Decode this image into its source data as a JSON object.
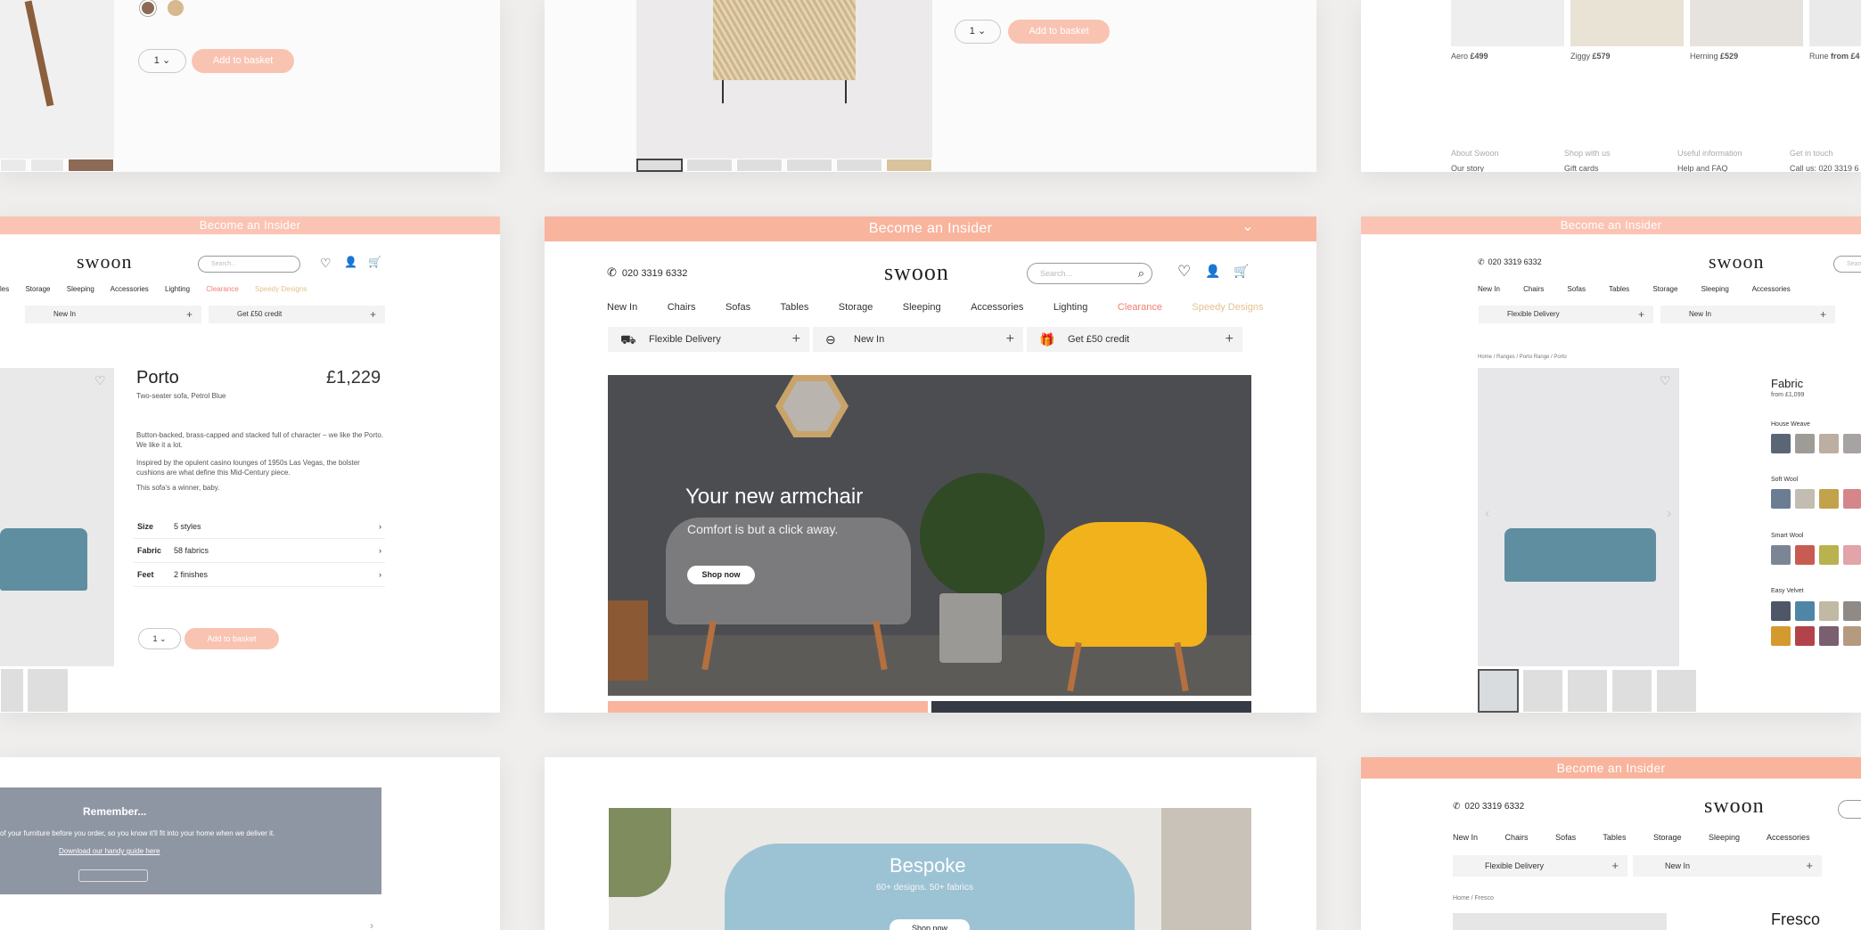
{
  "brand": {
    "logo": "swoon",
    "phone": "020 3319 6332",
    "accent": "#f9b49d",
    "search_placeholder": "Search..."
  },
  "insider": "Become an Insider",
  "nav": [
    "New In",
    "Chairs",
    "Sofas",
    "Tables",
    "Storage",
    "Sleeping",
    "Accessories",
    "Lighting",
    "Clearance",
    "Speedy Designs"
  ],
  "benefits": [
    "Flexible Delivery",
    "New In",
    "Get £50 credit"
  ],
  "hero": {
    "title": "Your new armchair",
    "subtitle": "Comfort is but a click away.",
    "cta": "Shop now"
  },
  "product": {
    "name": "Porto",
    "price": "£1,229",
    "subtitle": "Two-seater sofa, Petrol Blue",
    "desc1": "Button-backed, brass-capped and stacked full of character – we like the Porto. We like it a lot.",
    "desc2": "Inspired by the opulent casino lounges of 1950s Las Vegas, the bolster cushions are what define this Mid-Century piece.",
    "desc3": "This sofa's a winner, baby.",
    "specs": [
      {
        "label": "Size",
        "value": "5 styles"
      },
      {
        "label": "Fabric",
        "value": "58 fabrics"
      },
      {
        "label": "Feet",
        "value": "2 finishes"
      }
    ],
    "qty": "1",
    "add_to_basket": "Add to basket"
  },
  "fabric": {
    "title": "Fabric",
    "from": "from £1,099",
    "groups": [
      "House Weave",
      "Soft Wool",
      "Smart Wool",
      "Easy Velvet"
    ],
    "breadcrumb": "Home / Ranges / Porto Range / Porto"
  },
  "related": [
    {
      "name": "Aero",
      "price": "£499"
    },
    {
      "name": "Ziggy",
      "price": "£579"
    },
    {
      "name": "Herning",
      "price": "£529"
    },
    {
      "name": "Rune",
      "price": "from £4"
    }
  ],
  "footer": {
    "headings": [
      "About Swoon",
      "Shop with us",
      "Useful information",
      "Get in touch"
    ],
    "links": [
      "Our story",
      "Gift cards",
      "Help and FAQ",
      "Call us: 020 3319 6"
    ]
  },
  "remember": {
    "title": "Remember...",
    "body": "of your furniture before you order, so you know it'll fit into your home when we deliver it.",
    "link": "Download our handy guide here"
  },
  "bespoke": {
    "title": "Bespoke",
    "subtitle": "60+ designs. 50+ fabrics",
    "cta": "Shop now"
  },
  "fresco": {
    "breadcrumb": "Home / Fresco",
    "title": "Fresco"
  }
}
